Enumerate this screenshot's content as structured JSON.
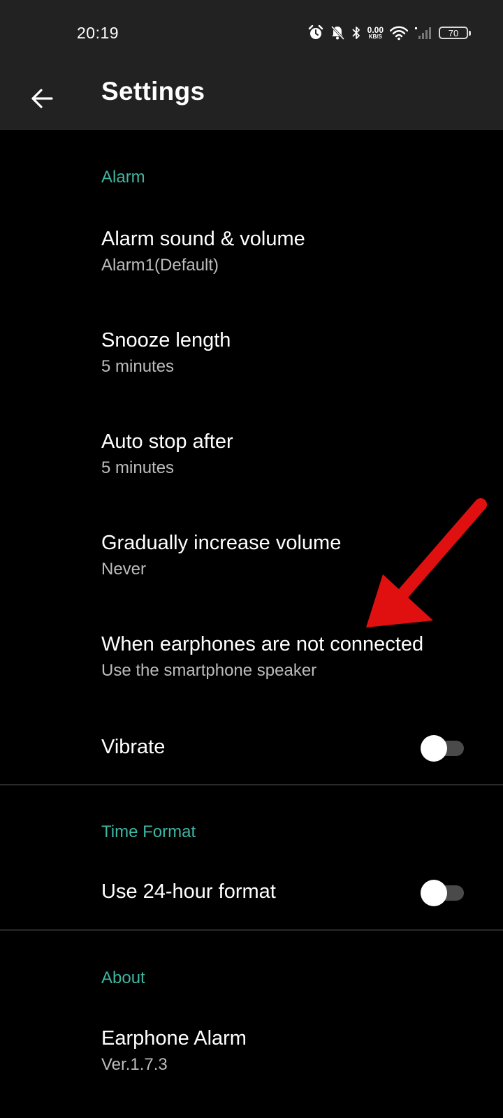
{
  "status_bar": {
    "time": "20:19",
    "net_speed_value": "0.00",
    "net_speed_unit": "KB/S",
    "battery_level": "70",
    "icons": [
      "alarm-icon",
      "mute-bell-icon",
      "bluetooth-icon",
      "wifi-icon",
      "signal-icon"
    ]
  },
  "header": {
    "title": "Settings",
    "back_icon": "arrow-left-icon"
  },
  "sections": {
    "alarm": {
      "header": "Alarm",
      "items": [
        {
          "title": "Alarm sound & volume",
          "subtitle": "Alarm1(Default)"
        },
        {
          "title": "Snooze length",
          "subtitle": "5 minutes"
        },
        {
          "title": "Auto stop after",
          "subtitle": "5 minutes"
        },
        {
          "title": "Gradually increase volume",
          "subtitle": "Never"
        },
        {
          "title": "When earphones are not connected",
          "subtitle": "Use the smartphone speaker"
        }
      ],
      "vibrate": {
        "label": "Vibrate",
        "enabled": false
      }
    },
    "time_format": {
      "header": "Time Format",
      "use_24_hour": {
        "label": "Use 24-hour format",
        "enabled": false
      }
    },
    "about": {
      "header": "About",
      "app_name": "Earphone Alarm",
      "version": "Ver.1.7.3"
    }
  },
  "colors": {
    "accent": "#3fb6a2",
    "background": "#000000",
    "app_bar": "#222222",
    "annotation_arrow": "#e01010"
  }
}
